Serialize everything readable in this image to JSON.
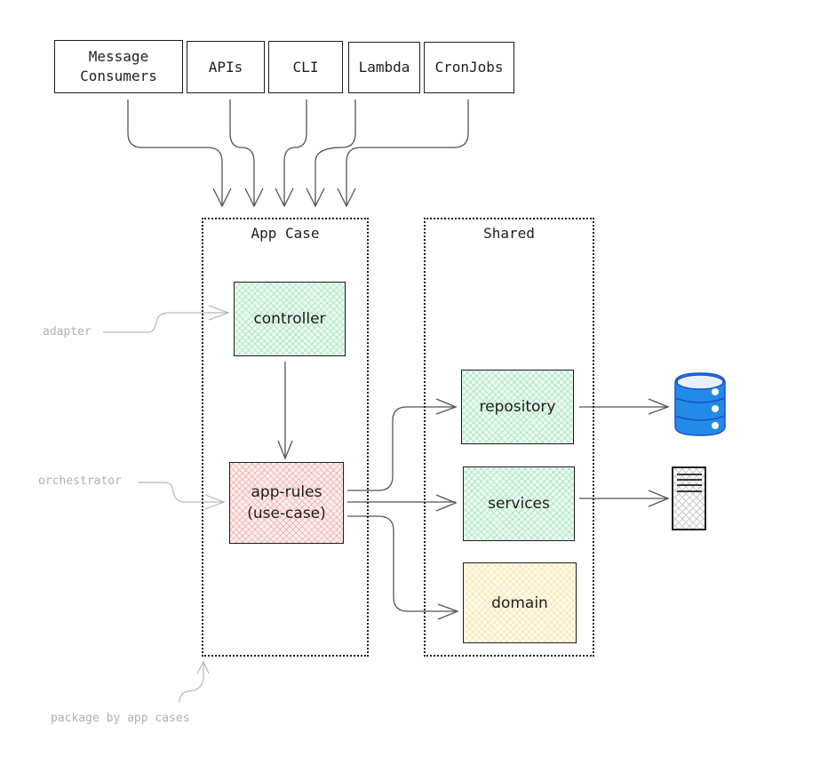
{
  "entry_points": [
    {
      "id": "message-consumers",
      "label": "Message\nConsumers"
    },
    {
      "id": "apis",
      "label": "APIs"
    },
    {
      "id": "cli",
      "label": "CLI"
    },
    {
      "id": "lambda",
      "label": "Lambda"
    },
    {
      "id": "cronjobs",
      "label": "CronJobs"
    }
  ],
  "groups": {
    "app_case": {
      "title": "App Case"
    },
    "shared": {
      "title": "Shared"
    }
  },
  "components": {
    "controller": {
      "label": "controller",
      "fill": "green"
    },
    "app_rules": {
      "label": "app-rules\n(use-case)",
      "fill": "red"
    },
    "repository": {
      "label": "repository",
      "fill": "green"
    },
    "services": {
      "label": "services",
      "fill": "green"
    },
    "domain": {
      "label": "domain",
      "fill": "yellow"
    }
  },
  "annotations": {
    "adapter": "adapter",
    "orchestrator": "orchestrator",
    "package": "package by app cases"
  },
  "icons": {
    "database": {
      "name": "database-icon",
      "color": "#228be6"
    },
    "server": {
      "name": "server-icon",
      "color": "#1e1e1e"
    }
  },
  "colors": {
    "stroke": "#1e1e1e",
    "annotation": "#b0b0b0",
    "green_fill": "#b2f2bb",
    "red_fill": "#ffc9c9",
    "yellow_fill": "#ffec99"
  }
}
